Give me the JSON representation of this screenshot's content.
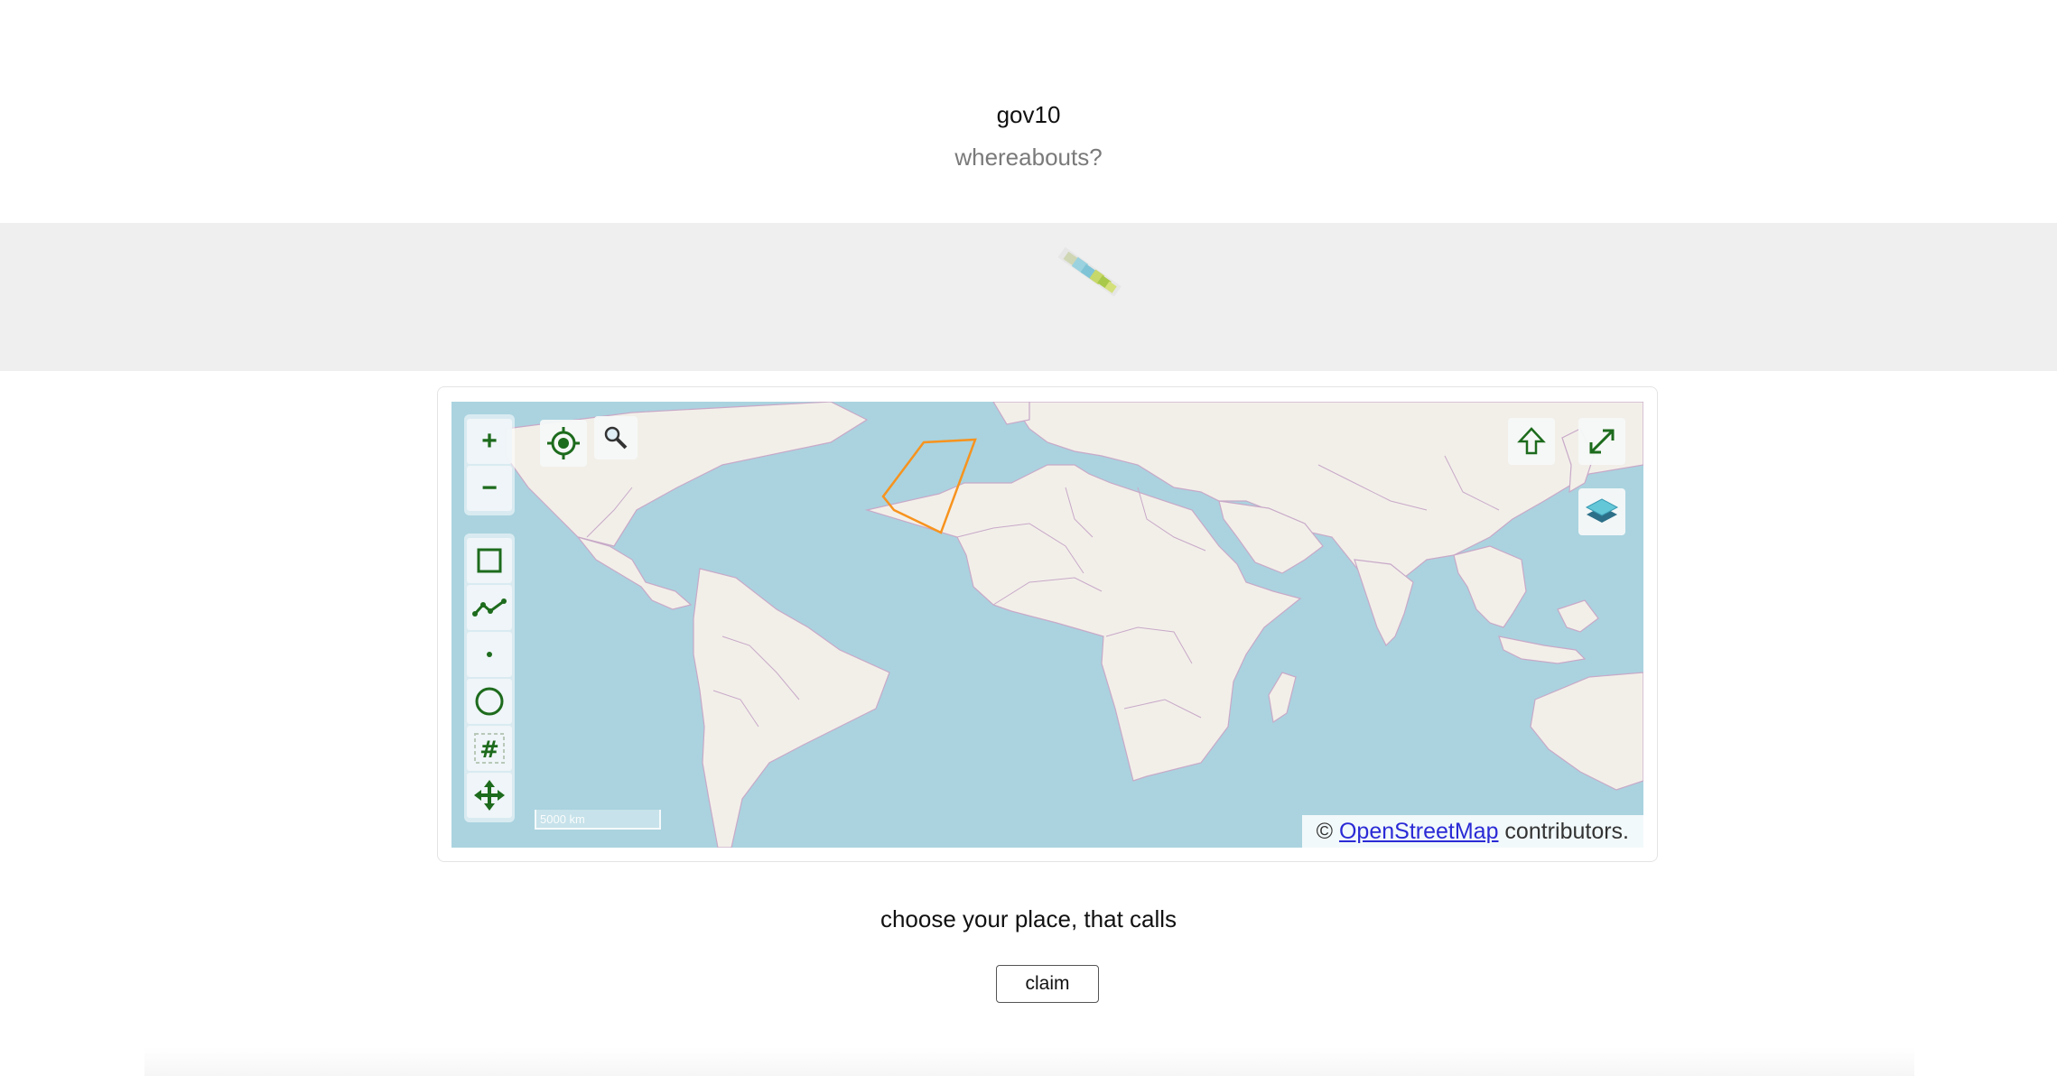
{
  "header": {
    "title": "gov10",
    "subtitle": "whereabouts?"
  },
  "map": {
    "zoom_in_label": "+",
    "zoom_out_label": "−",
    "scale_label": "5000 km",
    "attribution": {
      "prefix": "© ",
      "link_text": "OpenStreetMap",
      "suffix": " contributors."
    },
    "colors": {
      "water": "#aad3df",
      "land": "#f2efe9",
      "border": "#c8a9c8",
      "selection": "#f7931e",
      "control_icon": "#1d6b1d"
    },
    "tools": [
      "rectangle-icon",
      "polyline-icon",
      "point-icon",
      "circle-icon",
      "grid-icon",
      "move-icon"
    ]
  },
  "prompt": "choose your place, that calls",
  "claim_label": "claim"
}
